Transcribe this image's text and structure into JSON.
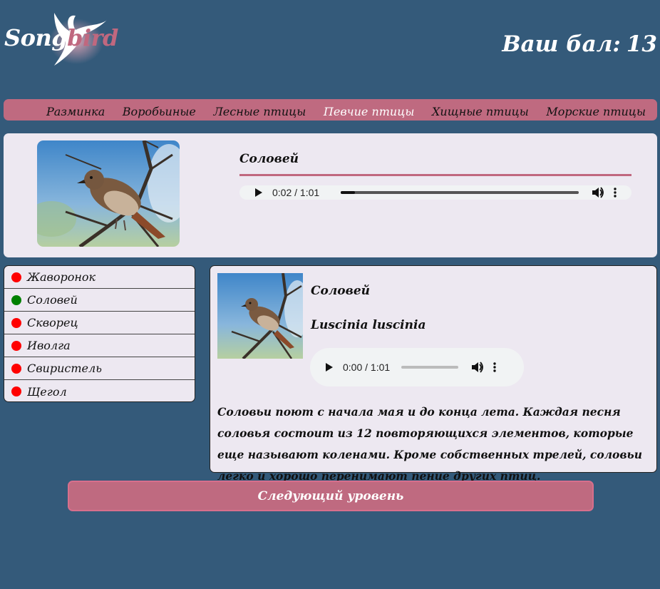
{
  "header": {
    "logo_main": "Song",
    "logo_accent": "bird",
    "score_label": "Ваш бал:",
    "score_value": "13"
  },
  "nav": {
    "items": [
      {
        "label": "Разминка",
        "active": false
      },
      {
        "label": "Воробьиные",
        "active": false
      },
      {
        "label": "Лесные птицы",
        "active": false
      },
      {
        "label": "Певчие птицы",
        "active": true
      },
      {
        "label": "Хищные птицы",
        "active": false
      },
      {
        "label": "Морские птицы",
        "active": false
      }
    ]
  },
  "question": {
    "bird_name": "Соловей",
    "audio": {
      "time": "0:02 / 1:01",
      "progress": 0.06
    }
  },
  "answers": [
    {
      "label": "Жаворонок",
      "status_color": "#ff0000"
    },
    {
      "label": "Соловей",
      "status_color": "#008000"
    },
    {
      "label": "Скворец",
      "status_color": "#ff0000"
    },
    {
      "label": "Иволга",
      "status_color": "#ff0000"
    },
    {
      "label": "Свиристель",
      "status_color": "#ff0000"
    },
    {
      "label": "Щегол",
      "status_color": "#ff0000"
    }
  ],
  "info": {
    "name": "Соловей",
    "latin": "Luscinia luscinia",
    "audio": {
      "time": "0:00 / 1:01",
      "progress": 0
    },
    "description": "Соловьи поют с начала мая и до конца лета. Каждая песня соловья состоит из 12 повторяющихся элементов, которые еще называют коленами. Кроме собственных трелей, соловьи легко и хорошо перенимают пение других птиц."
  },
  "next_button": "Следующий уровень",
  "colors": {
    "background": "#345a7a",
    "accent": "#bf6a80",
    "panel": "#ede8f1",
    "correct": "#008000",
    "wrong": "#ff0000"
  }
}
